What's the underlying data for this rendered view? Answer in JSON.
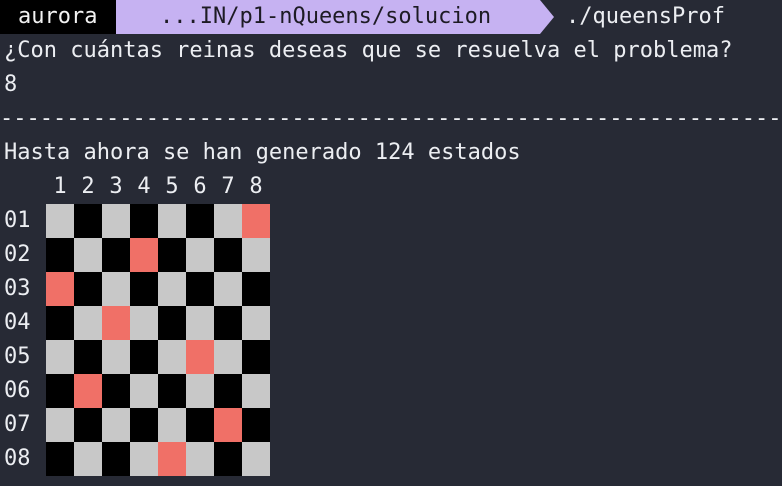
{
  "prompt": {
    "host": "aurora",
    "path": "...IN/p1-nQueens/solucion",
    "command": "./queensProf"
  },
  "question": "¿Con cuántas reinas deseas que se resuelva el problema?",
  "answer": "8",
  "separator": "----------------------------------------------------------------------------------",
  "status": "Hasta ahora se han generado 124 estados",
  "board": {
    "columns": [
      "1",
      "2",
      "3",
      "4",
      "5",
      "6",
      "7",
      "8"
    ],
    "rows": [
      "01",
      "02",
      "03",
      "04",
      "05",
      "06",
      "07",
      "08"
    ],
    "queen_columns": [
      8,
      4,
      1,
      3,
      6,
      2,
      7,
      5
    ]
  },
  "colors": {
    "background": "#272a35",
    "light_square": "#c8c8c8",
    "dark_square": "#000000",
    "queen_square": "#f07067",
    "path_segment": "#c6b2f2"
  }
}
